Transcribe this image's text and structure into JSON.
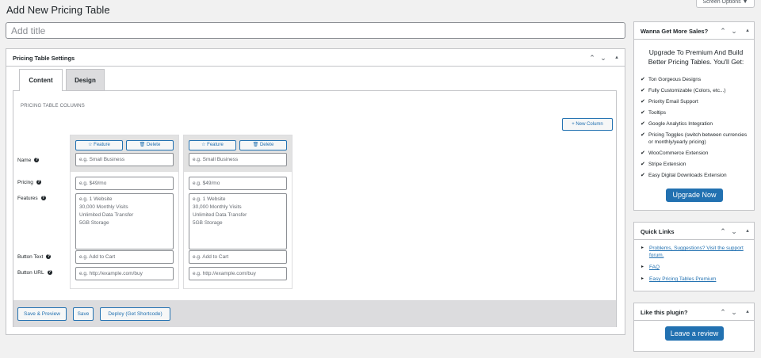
{
  "page": {
    "title": "Add New Pricing Table",
    "screen_options": "Screen Options ▼",
    "title_placeholder": "Add title"
  },
  "settings_box": {
    "title": "Pricing Table Settings",
    "tabs": [
      {
        "label": "Content",
        "active": true
      },
      {
        "label": "Design",
        "active": false
      }
    ],
    "section_label": "PRICING TABLE COLUMNS",
    "new_column_label": "+ New Column",
    "row_labels": {
      "name": "Name",
      "pricing": "Pricing",
      "features": "Features",
      "button_text": "Button Text",
      "button_url": "Button URL"
    },
    "columns": [
      {
        "feature_label": "☆ Feature",
        "delete_label": "🗑 Delete",
        "name_placeholder": "e.g. Small Business",
        "pricing_placeholder": "e.g. $49/mo",
        "features_lines": [
          "e.g. 1 Website",
          "30,000 Monthly Visits",
          "Unlimited Data Transfer",
          "5GB Storage"
        ],
        "button_text_placeholder": "e.g. Add to Cart",
        "button_url_placeholder": "e.g. http://example.com/buy"
      },
      {
        "feature_label": "☆ Feature",
        "delete_label": "🗑 Delete",
        "name_placeholder": "e.g. Small Business",
        "pricing_placeholder": "e.g. $49/mo",
        "features_lines": [
          "e.g. 1 Website",
          "30,000 Monthly Visits",
          "Unlimited Data Transfer",
          "5GB Storage"
        ],
        "button_text_placeholder": "e.g. Add to Cart",
        "button_url_placeholder": "e.g. http://example.com/buy"
      }
    ],
    "footer_buttons": {
      "save_preview": "Save & Preview",
      "save": "Save",
      "deploy": "Deploy (Get Shortcode)"
    }
  },
  "sidebar": {
    "sales_box": {
      "title": "Wanna Get More Sales?",
      "intro": "Upgrade To Premium And Build Better Pricing Tables. You'll Get:",
      "features": [
        "Ton Gorgeous Designs",
        "Fully Customizable (Colors, etc...)",
        "Priority Email Support",
        "Tooltips",
        "Google Analytics Integration",
        "Pricing Toggles (switch between currencies or monthly/yearly pricing)",
        "WooCommerce Extension",
        "Stripe Extension",
        "Easy Digital Downloads Extension"
      ],
      "upgrade_label": "Upgrade Now"
    },
    "quick_links": {
      "title": "Quick Links",
      "links": [
        "Problems, Suggestions? Visit the support forum.",
        "FAQ",
        "Easy Pricing Tables Premium"
      ]
    },
    "like_box": {
      "title": "Like this plugin?",
      "review_label": "Leave a review"
    }
  },
  "icons": {
    "collapse_up": "⌃",
    "collapse_down": "⌄",
    "toggle": "▴",
    "check": "✔",
    "arrow": "▸",
    "help": "?"
  },
  "colors": {
    "accent": "#2271b1",
    "background": "#f1f1f1"
  }
}
